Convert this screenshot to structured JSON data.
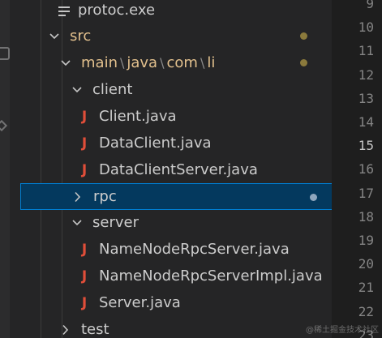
{
  "colors": {
    "sidebar_bg": "#252526",
    "editor_bg": "#1e1e1e",
    "selection_bg": "#04395e",
    "selection_border": "#007fd4",
    "java_icon": "#e04e39",
    "modified_folder": "#e2c08d",
    "modified_dot": "#8b7a3c",
    "untracked_dot": "#8fa6bd"
  },
  "explorer": {
    "items": [
      {
        "label": "protoc.exe",
        "icon": "lines-file-icon",
        "depth": 2
      },
      {
        "label": "src",
        "icon": "chevron-down-icon",
        "depth": 1,
        "dot": "modified"
      },
      {
        "path": [
          "main",
          "java",
          "com",
          "li"
        ],
        "icon": "chevron-down-icon",
        "depth": 2,
        "dot": "modified"
      },
      {
        "label": "client",
        "icon": "chevron-down-icon",
        "depth": 3
      },
      {
        "label": "Client.java",
        "icon": "java-icon",
        "depth": 4
      },
      {
        "label": "DataClient.java",
        "icon": "java-icon",
        "depth": 4
      },
      {
        "label": "DataClientServer.java",
        "icon": "java-icon",
        "depth": 4
      },
      {
        "label": "rpc",
        "icon": "chevron-right-icon",
        "depth": 3,
        "selected": true,
        "dot": "untracked"
      },
      {
        "label": "server",
        "icon": "chevron-down-icon",
        "depth": 3
      },
      {
        "label": "NameNodeRpcServer.java",
        "icon": "java-icon",
        "depth": 4
      },
      {
        "label": "NameNodeRpcServerImpl.java",
        "icon": "java-icon",
        "depth": 4
      },
      {
        "label": "Server.java",
        "icon": "java-icon",
        "depth": 4
      },
      {
        "label": "test",
        "icon": "chevron-right-icon",
        "depth": 2
      }
    ],
    "path_separator": "\\",
    "java_glyph": "J"
  },
  "gutter": {
    "line_numbers": [
      "9",
      "10",
      "11",
      "12",
      "13",
      "14",
      "15",
      "16",
      "17",
      "18",
      "19",
      "20",
      "21",
      "22",
      "23"
    ],
    "active_line": "15"
  },
  "watermark": "@稀土掘金技术社区"
}
